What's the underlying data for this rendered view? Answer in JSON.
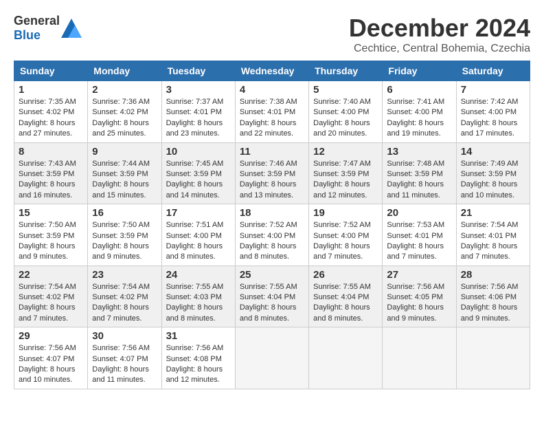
{
  "logo": {
    "general": "General",
    "blue": "Blue"
  },
  "header": {
    "month": "December 2024",
    "location": "Cechtice, Central Bohemia, Czechia"
  },
  "days_of_week": [
    "Sunday",
    "Monday",
    "Tuesday",
    "Wednesday",
    "Thursday",
    "Friday",
    "Saturday"
  ],
  "weeks": [
    [
      {
        "day": "1",
        "sunrise": "Sunrise: 7:35 AM",
        "sunset": "Sunset: 4:02 PM",
        "daylight": "Daylight: 8 hours and 27 minutes."
      },
      {
        "day": "2",
        "sunrise": "Sunrise: 7:36 AM",
        "sunset": "Sunset: 4:02 PM",
        "daylight": "Daylight: 8 hours and 25 minutes."
      },
      {
        "day": "3",
        "sunrise": "Sunrise: 7:37 AM",
        "sunset": "Sunset: 4:01 PM",
        "daylight": "Daylight: 8 hours and 23 minutes."
      },
      {
        "day": "4",
        "sunrise": "Sunrise: 7:38 AM",
        "sunset": "Sunset: 4:01 PM",
        "daylight": "Daylight: 8 hours and 22 minutes."
      },
      {
        "day": "5",
        "sunrise": "Sunrise: 7:40 AM",
        "sunset": "Sunset: 4:00 PM",
        "daylight": "Daylight: 8 hours and 20 minutes."
      },
      {
        "day": "6",
        "sunrise": "Sunrise: 7:41 AM",
        "sunset": "Sunset: 4:00 PM",
        "daylight": "Daylight: 8 hours and 19 minutes."
      },
      {
        "day": "7",
        "sunrise": "Sunrise: 7:42 AM",
        "sunset": "Sunset: 4:00 PM",
        "daylight": "Daylight: 8 hours and 17 minutes."
      }
    ],
    [
      {
        "day": "8",
        "sunrise": "Sunrise: 7:43 AM",
        "sunset": "Sunset: 3:59 PM",
        "daylight": "Daylight: 8 hours and 16 minutes."
      },
      {
        "day": "9",
        "sunrise": "Sunrise: 7:44 AM",
        "sunset": "Sunset: 3:59 PM",
        "daylight": "Daylight: 8 hours and 15 minutes."
      },
      {
        "day": "10",
        "sunrise": "Sunrise: 7:45 AM",
        "sunset": "Sunset: 3:59 PM",
        "daylight": "Daylight: 8 hours and 14 minutes."
      },
      {
        "day": "11",
        "sunrise": "Sunrise: 7:46 AM",
        "sunset": "Sunset: 3:59 PM",
        "daylight": "Daylight: 8 hours and 13 minutes."
      },
      {
        "day": "12",
        "sunrise": "Sunrise: 7:47 AM",
        "sunset": "Sunset: 3:59 PM",
        "daylight": "Daylight: 8 hours and 12 minutes."
      },
      {
        "day": "13",
        "sunrise": "Sunrise: 7:48 AM",
        "sunset": "Sunset: 3:59 PM",
        "daylight": "Daylight: 8 hours and 11 minutes."
      },
      {
        "day": "14",
        "sunrise": "Sunrise: 7:49 AM",
        "sunset": "Sunset: 3:59 PM",
        "daylight": "Daylight: 8 hours and 10 minutes."
      }
    ],
    [
      {
        "day": "15",
        "sunrise": "Sunrise: 7:50 AM",
        "sunset": "Sunset: 3:59 PM",
        "daylight": "Daylight: 8 hours and 9 minutes."
      },
      {
        "day": "16",
        "sunrise": "Sunrise: 7:50 AM",
        "sunset": "Sunset: 3:59 PM",
        "daylight": "Daylight: 8 hours and 9 minutes."
      },
      {
        "day": "17",
        "sunrise": "Sunrise: 7:51 AM",
        "sunset": "Sunset: 4:00 PM",
        "daylight": "Daylight: 8 hours and 8 minutes."
      },
      {
        "day": "18",
        "sunrise": "Sunrise: 7:52 AM",
        "sunset": "Sunset: 4:00 PM",
        "daylight": "Daylight: 8 hours and 8 minutes."
      },
      {
        "day": "19",
        "sunrise": "Sunrise: 7:52 AM",
        "sunset": "Sunset: 4:00 PM",
        "daylight": "Daylight: 8 hours and 7 minutes."
      },
      {
        "day": "20",
        "sunrise": "Sunrise: 7:53 AM",
        "sunset": "Sunset: 4:01 PM",
        "daylight": "Daylight: 8 hours and 7 minutes."
      },
      {
        "day": "21",
        "sunrise": "Sunrise: 7:54 AM",
        "sunset": "Sunset: 4:01 PM",
        "daylight": "Daylight: 8 hours and 7 minutes."
      }
    ],
    [
      {
        "day": "22",
        "sunrise": "Sunrise: 7:54 AM",
        "sunset": "Sunset: 4:02 PM",
        "daylight": "Daylight: 8 hours and 7 minutes."
      },
      {
        "day": "23",
        "sunrise": "Sunrise: 7:54 AM",
        "sunset": "Sunset: 4:02 PM",
        "daylight": "Daylight: 8 hours and 7 minutes."
      },
      {
        "day": "24",
        "sunrise": "Sunrise: 7:55 AM",
        "sunset": "Sunset: 4:03 PM",
        "daylight": "Daylight: 8 hours and 8 minutes."
      },
      {
        "day": "25",
        "sunrise": "Sunrise: 7:55 AM",
        "sunset": "Sunset: 4:04 PM",
        "daylight": "Daylight: 8 hours and 8 minutes."
      },
      {
        "day": "26",
        "sunrise": "Sunrise: 7:55 AM",
        "sunset": "Sunset: 4:04 PM",
        "daylight": "Daylight: 8 hours and 8 minutes."
      },
      {
        "day": "27",
        "sunrise": "Sunrise: 7:56 AM",
        "sunset": "Sunset: 4:05 PM",
        "daylight": "Daylight: 8 hours and 9 minutes."
      },
      {
        "day": "28",
        "sunrise": "Sunrise: 7:56 AM",
        "sunset": "Sunset: 4:06 PM",
        "daylight": "Daylight: 8 hours and 9 minutes."
      }
    ],
    [
      {
        "day": "29",
        "sunrise": "Sunrise: 7:56 AM",
        "sunset": "Sunset: 4:07 PM",
        "daylight": "Daylight: 8 hours and 10 minutes."
      },
      {
        "day": "30",
        "sunrise": "Sunrise: 7:56 AM",
        "sunset": "Sunset: 4:07 PM",
        "daylight": "Daylight: 8 hours and 11 minutes."
      },
      {
        "day": "31",
        "sunrise": "Sunrise: 7:56 AM",
        "sunset": "Sunset: 4:08 PM",
        "daylight": "Daylight: 8 hours and 12 minutes."
      },
      null,
      null,
      null,
      null
    ]
  ]
}
